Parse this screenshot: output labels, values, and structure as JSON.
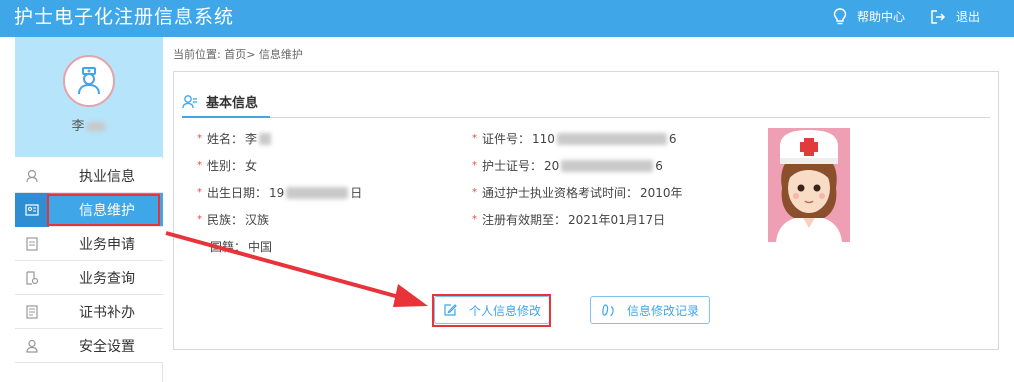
{
  "header": {
    "title": "护士电子化注册信息系统",
    "help_label": "帮助中心",
    "logout_label": "退出"
  },
  "sidebar": {
    "user_name": "李",
    "items": [
      {
        "label": "执业信息",
        "icon": "badge-icon"
      },
      {
        "label": "信息维护",
        "icon": "id-card-icon",
        "active": true
      },
      {
        "label": "业务申请",
        "icon": "form-icon"
      },
      {
        "label": "业务查询",
        "icon": "search-doc-icon"
      },
      {
        "label": "证书补办",
        "icon": "certificate-icon"
      },
      {
        "label": "安全设置",
        "icon": "user-lock-icon"
      }
    ]
  },
  "breadcrumb": {
    "text": "当前位置: 首页> 信息维护"
  },
  "basic_info": {
    "section_title": "基本信息",
    "left_fields": [
      {
        "label": "姓名：",
        "value": "李"
      },
      {
        "label": "性别：",
        "value": "女"
      },
      {
        "label": "出生日期：",
        "value_prefix": "19",
        "value_suffix": "日"
      },
      {
        "label": "民族：",
        "value": "汉族"
      },
      {
        "label": "国籍：",
        "value": "中国"
      }
    ],
    "right_fields": [
      {
        "label": "证件号：",
        "value_prefix": "110",
        "value_suffix": "6"
      },
      {
        "label": "护士证号：",
        "value_prefix": "20",
        "value_suffix": "6"
      },
      {
        "label": "通过护士执业资格考试时间：",
        "value": "2010年"
      },
      {
        "label": "注册有效期至：",
        "value": "2021年01月17日"
      }
    ]
  },
  "actions": {
    "edit_label": "个人信息修改",
    "log_label": "信息修改记录"
  },
  "colors": {
    "header": "#3fa6e8",
    "accent": "#3fa6e8",
    "highlight": "#e8333a",
    "profile_bg": "#b6e4fa"
  }
}
